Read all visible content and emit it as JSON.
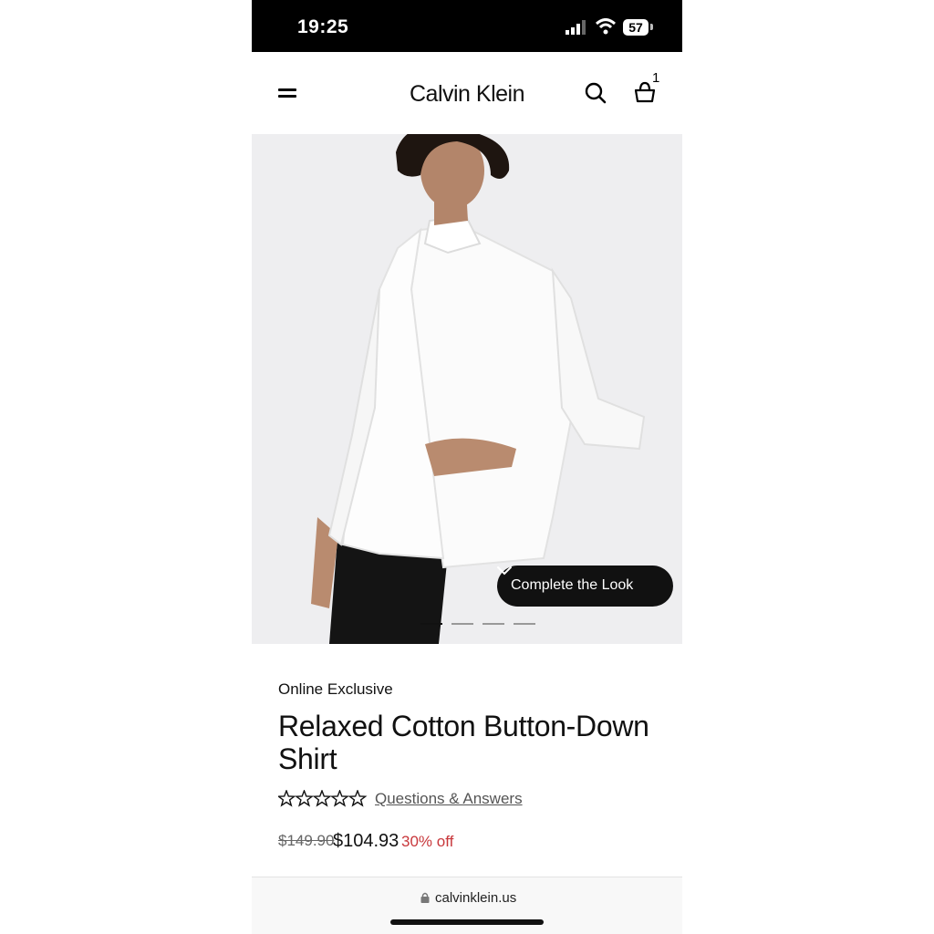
{
  "status_bar": {
    "time": "19:25",
    "battery": "57",
    "icons": [
      "signal-icon",
      "wifi-icon",
      "battery-icon"
    ]
  },
  "header": {
    "brand": "Calvin Klein",
    "cart_count": "1",
    "icons": [
      "menu-icon",
      "search-icon",
      "shopping-bag-icon"
    ]
  },
  "hero": {
    "complete_the_look_label": "Complete the Look",
    "carousel_pages": 4,
    "carousel_active": 1
  },
  "product": {
    "badge": "Online Exclusive",
    "title": "Relaxed Cotton Button-Down Shirt",
    "rating": 0,
    "rating_max": 5,
    "qa_link": "Questions & Answers",
    "price_original": "$149.90",
    "price_sale": "$104.93",
    "discount": "30% off"
  },
  "browser": {
    "url": "calvinklein.us"
  },
  "colors": {
    "discount": "#c8373b",
    "button_bg": "#111111",
    "hero_bg": "#eeeef0"
  }
}
